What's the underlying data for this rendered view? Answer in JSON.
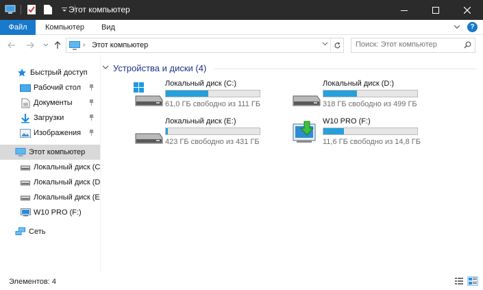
{
  "window": {
    "title": "Этот компьютер",
    "controls": [
      "minimize-icon",
      "maximize-icon",
      "close-icon"
    ]
  },
  "ribbon": {
    "tabs": [
      {
        "label": "Файл"
      },
      {
        "label": "Компьютер"
      },
      {
        "label": "Вид"
      }
    ],
    "help_label": "?"
  },
  "address": {
    "path": "Этот компьютер",
    "search_placeholder": "Поиск: Этот компьютер"
  },
  "sidebar": {
    "quick_access": {
      "label": "Быстрый доступ",
      "items": [
        {
          "label": "Рабочий стол",
          "icon": "desktop-icon",
          "pinned": true
        },
        {
          "label": "Документы",
          "icon": "documents-icon",
          "pinned": true
        },
        {
          "label": "Загрузки",
          "icon": "download-icon",
          "pinned": true
        },
        {
          "label": "Изображения",
          "icon": "pictures-icon",
          "pinned": true
        }
      ]
    },
    "this_pc": {
      "label": "Этот компьютер",
      "selected": true,
      "items": [
        {
          "label": "Локальный диск (C"
        },
        {
          "label": "Локальный диск (D"
        },
        {
          "label": "Локальный диск (E"
        },
        {
          "label": "W10 PRO (F:)"
        }
      ]
    },
    "network": {
      "label": "Сеть"
    }
  },
  "main": {
    "group_title": "Устройства и диски (4)",
    "drives": [
      {
        "name": "Локальный диск (C:)",
        "free": "61,0 ГБ свободно из 111 ГБ",
        "used_fraction": 0.45,
        "icon": "windows-drive-icon"
      },
      {
        "name": "Локальный диск (D:)",
        "free": "318 ГБ свободно из 499 ГБ",
        "used_fraction": 0.36,
        "icon": "hard-drive-icon"
      },
      {
        "name": "Локальный диск (E:)",
        "free": "423 ГБ свободно из 431 ГБ",
        "used_fraction": 0.02,
        "icon": "hard-drive-icon"
      },
      {
        "name": "W10 PRO (F:)",
        "free": "11,6 ГБ свободно из 14,8 ГБ",
        "used_fraction": 0.22,
        "icon": "usb-drive-icon"
      }
    ]
  },
  "status": {
    "items_count": "Элементов: 4"
  },
  "colors": {
    "accent": "#1979ca",
    "titlebar": "#2b2b2b",
    "progress": "#26a0da",
    "group_header": "#1e3287"
  }
}
